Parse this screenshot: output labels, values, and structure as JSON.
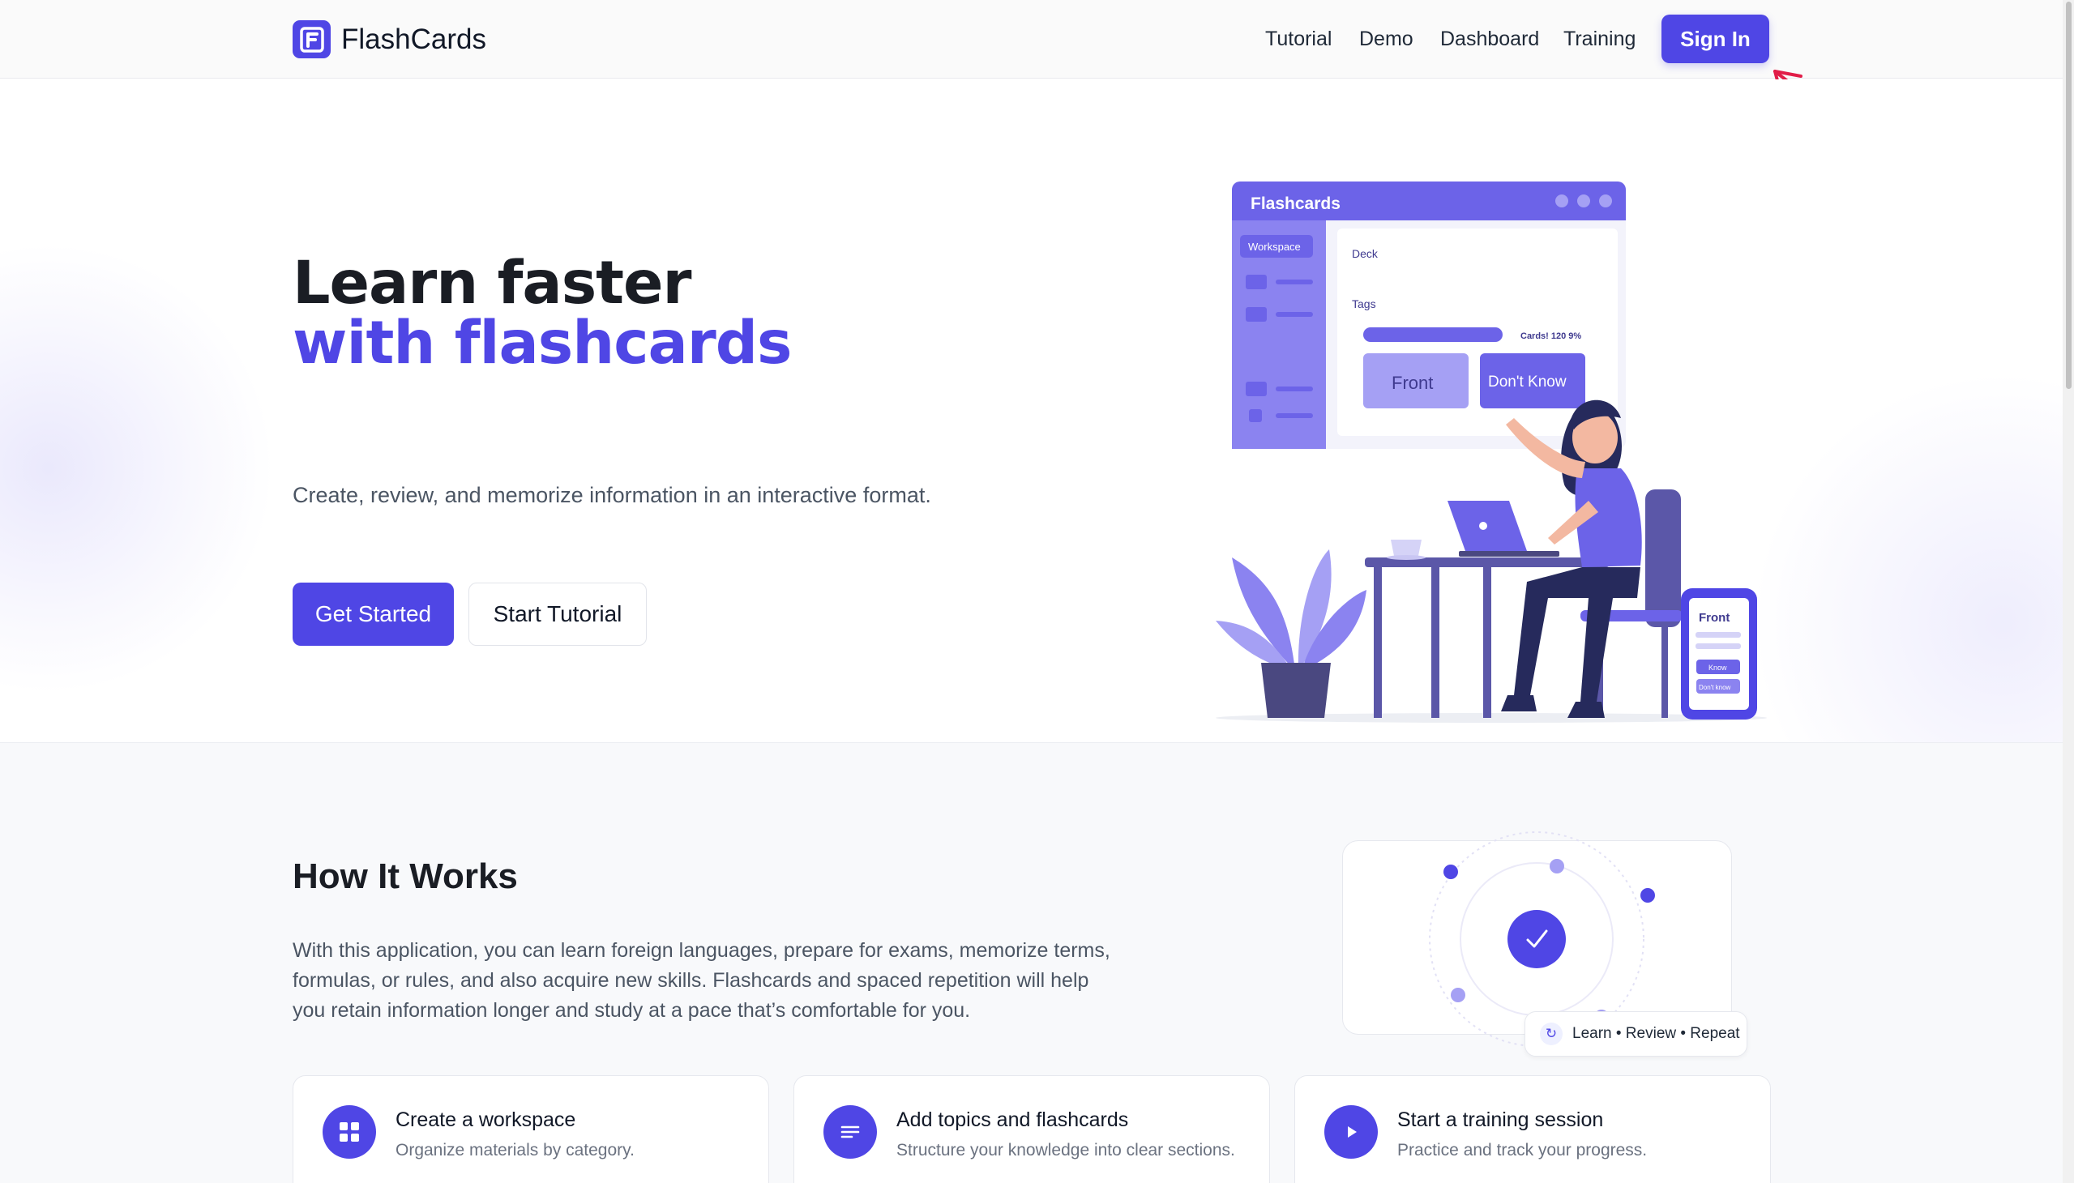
{
  "header": {
    "brand": "FlashCards",
    "nav": [
      "Tutorial",
      "Demo",
      "Dashboard",
      "Training"
    ],
    "signin_label": "Sign In"
  },
  "hero": {
    "title_line1": "Learn faster",
    "title_line2": "with flashcards",
    "subtitle": "Create, review, and memorize information in an interactive format.",
    "primary_cta": "Get Started",
    "secondary_cta": "Start Tutorial",
    "illustration": {
      "window_title": "Flashcards",
      "sidebar_label": "Workspace",
      "deck_label": "Deck",
      "tags_label": "Tags",
      "progress_text": "Cards! 120 9%",
      "front_button": "Front",
      "dont_know_button": "Don't Know",
      "phone_front": "Front",
      "phone_know": "Know",
      "phone_dont_know": "Don't know"
    }
  },
  "how": {
    "title": "How It Works",
    "description": "With this application, you can learn foreign languages, prepare for exams, memorize terms, formulas, or rules, and also acquire new skills. Flashcards and spaced repetition will help you retain information longer and study at a pace that’s comfortable for you.",
    "cycle_label": "Learn • Review • Repeat",
    "features": [
      {
        "title": "Create a workspace",
        "desc": "Organize materials by category.",
        "icon": "grid-icon"
      },
      {
        "title": "Add topics and flashcards",
        "desc": "Structure your knowledge into clear sections.",
        "icon": "list-icon"
      },
      {
        "title": "Start a training session",
        "desc": "Practice and track your progress.",
        "icon": "play-icon"
      }
    ]
  },
  "colors": {
    "accent": "#4f46e5",
    "accent_light": "#8b83f0",
    "annotation_arrow": "#e11d48"
  }
}
